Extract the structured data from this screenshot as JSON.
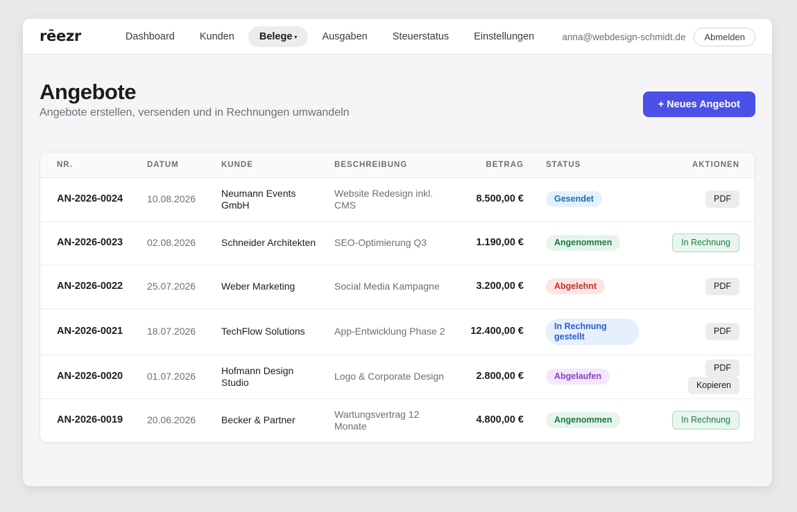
{
  "app": {
    "logo": "rēezr"
  },
  "nav": {
    "items": [
      {
        "label": "Dashboard",
        "active": false
      },
      {
        "label": "Kunden",
        "active": false
      },
      {
        "label": "Belege",
        "active": true,
        "caret": "▾"
      },
      {
        "label": "Ausgaben",
        "active": false
      },
      {
        "label": "Steuerstatus",
        "active": false
      },
      {
        "label": "Einstellungen",
        "active": false
      }
    ],
    "user_email": "anna@webdesign-schmidt.de",
    "logout_label": "Abmelden"
  },
  "page": {
    "title": "Angebote",
    "subtitle": "Angebote erstellen, versenden und in Rechnungen umwandeln",
    "new_button": "+ Neues Angebot"
  },
  "table": {
    "columns": [
      "NR.",
      "DATUM",
      "KUNDE",
      "BESCHREIBUNG",
      "BETRAG",
      "STATUS",
      "AKTIONEN"
    ],
    "rows": [
      {
        "nr": "AN-2026-0024",
        "date": "10.08.2026",
        "kunde": "Neumann Events GmbH",
        "desc": "Website Redesign inkl. CMS",
        "amount": "8.500,00 €",
        "status": "Gesendet",
        "status_type": "sent",
        "actions": [
          {
            "label": "PDF",
            "style": "gray"
          }
        ]
      },
      {
        "nr": "AN-2026-0023",
        "date": "02.08.2026",
        "kunde": "Schneider Architekten",
        "desc": "SEO-Optimierung Q3",
        "amount": "1.190,00 €",
        "status": "Angenommen",
        "status_type": "accepted",
        "actions": [
          {
            "label": "In Rechnung",
            "style": "green"
          }
        ]
      },
      {
        "nr": "AN-2026-0022",
        "date": "25.07.2026",
        "kunde": "Weber Marketing",
        "desc": "Social Media Kampagne",
        "amount": "3.200,00 €",
        "status": "Abgelehnt",
        "status_type": "rejected",
        "actions": [
          {
            "label": "PDF",
            "style": "gray"
          }
        ]
      },
      {
        "nr": "AN-2026-0021",
        "date": "18.07.2026",
        "kunde": "TechFlow Solutions",
        "desc": "App-Entwicklung Phase 2",
        "amount": "12.400,00 €",
        "status": "In Rechnung gestellt",
        "status_type": "invoiced",
        "actions": [
          {
            "label": "PDF",
            "style": "gray"
          }
        ]
      },
      {
        "nr": "AN-2026-0020",
        "date": "01.07.2026",
        "kunde": "Hofmann Design Studio",
        "desc": "Logo & Corporate Design",
        "amount": "2.800,00 €",
        "status": "Abgelaufen",
        "status_type": "expired",
        "actions": [
          {
            "label": "PDF",
            "style": "gray"
          },
          {
            "label": "Kopieren",
            "style": "gray"
          }
        ]
      },
      {
        "nr": "AN-2026-0019",
        "date": "20.06.2026",
        "kunde": "Becker & Partner",
        "desc": "Wartungsvertrag 12 Monate",
        "amount": "4.800,00 €",
        "status": "Angenommen",
        "status_type": "accepted",
        "actions": [
          {
            "label": "In Rechnung",
            "style": "green"
          }
        ]
      }
    ]
  },
  "status_colors": {
    "sent": {
      "bg": "#e3f1fb",
      "fg": "#1e6fa8"
    },
    "accepted": {
      "bg": "#e6f5ec",
      "fg": "#1e7a43"
    },
    "rejected": {
      "bg": "#fbe6e6",
      "fg": "#c0322f"
    },
    "invoiced": {
      "bg": "#e6effc",
      "fg": "#2a5fc9"
    },
    "expired": {
      "bg": "#f3e8fb",
      "fg": "#8a3fc2"
    }
  },
  "colors": {
    "accent": "#4a50e8"
  }
}
